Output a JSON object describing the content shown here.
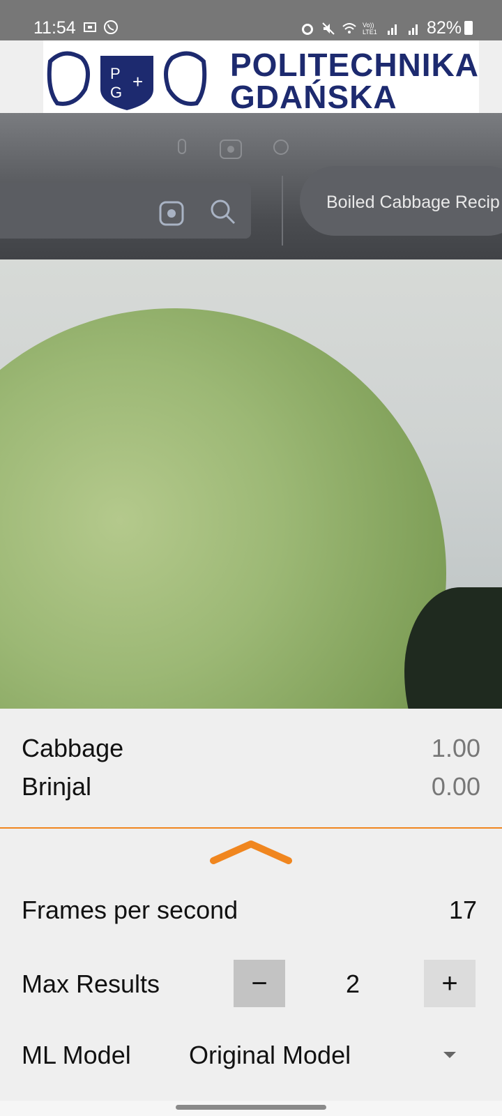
{
  "status_bar": {
    "time": "11:54",
    "battery_percent": "82%",
    "left_icons": [
      "screenshot-icon",
      "viber-icon"
    ],
    "right_icons": [
      "alarm-icon",
      "mute-icon",
      "wifi-icon",
      "volte-icon",
      "signal-icon",
      "signal-icon",
      "battery-icon"
    ],
    "volte_label": "Vo)) LTE1"
  },
  "banner": {
    "line1": "POLITECHNIKA",
    "line2": "GDAŃSKA",
    "logo_text": "PG",
    "brand_color": "#1d2a6f"
  },
  "camera": {
    "tab_text": "Boiled Cabbage Recip"
  },
  "results": [
    {
      "label": "Cabbage",
      "score": "1.00"
    },
    {
      "label": "Brinjal",
      "score": "0.00"
    }
  ],
  "settings": {
    "fps_label": "Frames per second",
    "fps_value": "17",
    "max_results_label": "Max Results",
    "max_results_value": "2",
    "minus_label": "−",
    "plus_label": "+",
    "model_label": "ML Model",
    "model_value": "Original Model"
  },
  "colors": {
    "accent": "#f0861f",
    "status_bar": "#777777",
    "background": "#efefef"
  }
}
